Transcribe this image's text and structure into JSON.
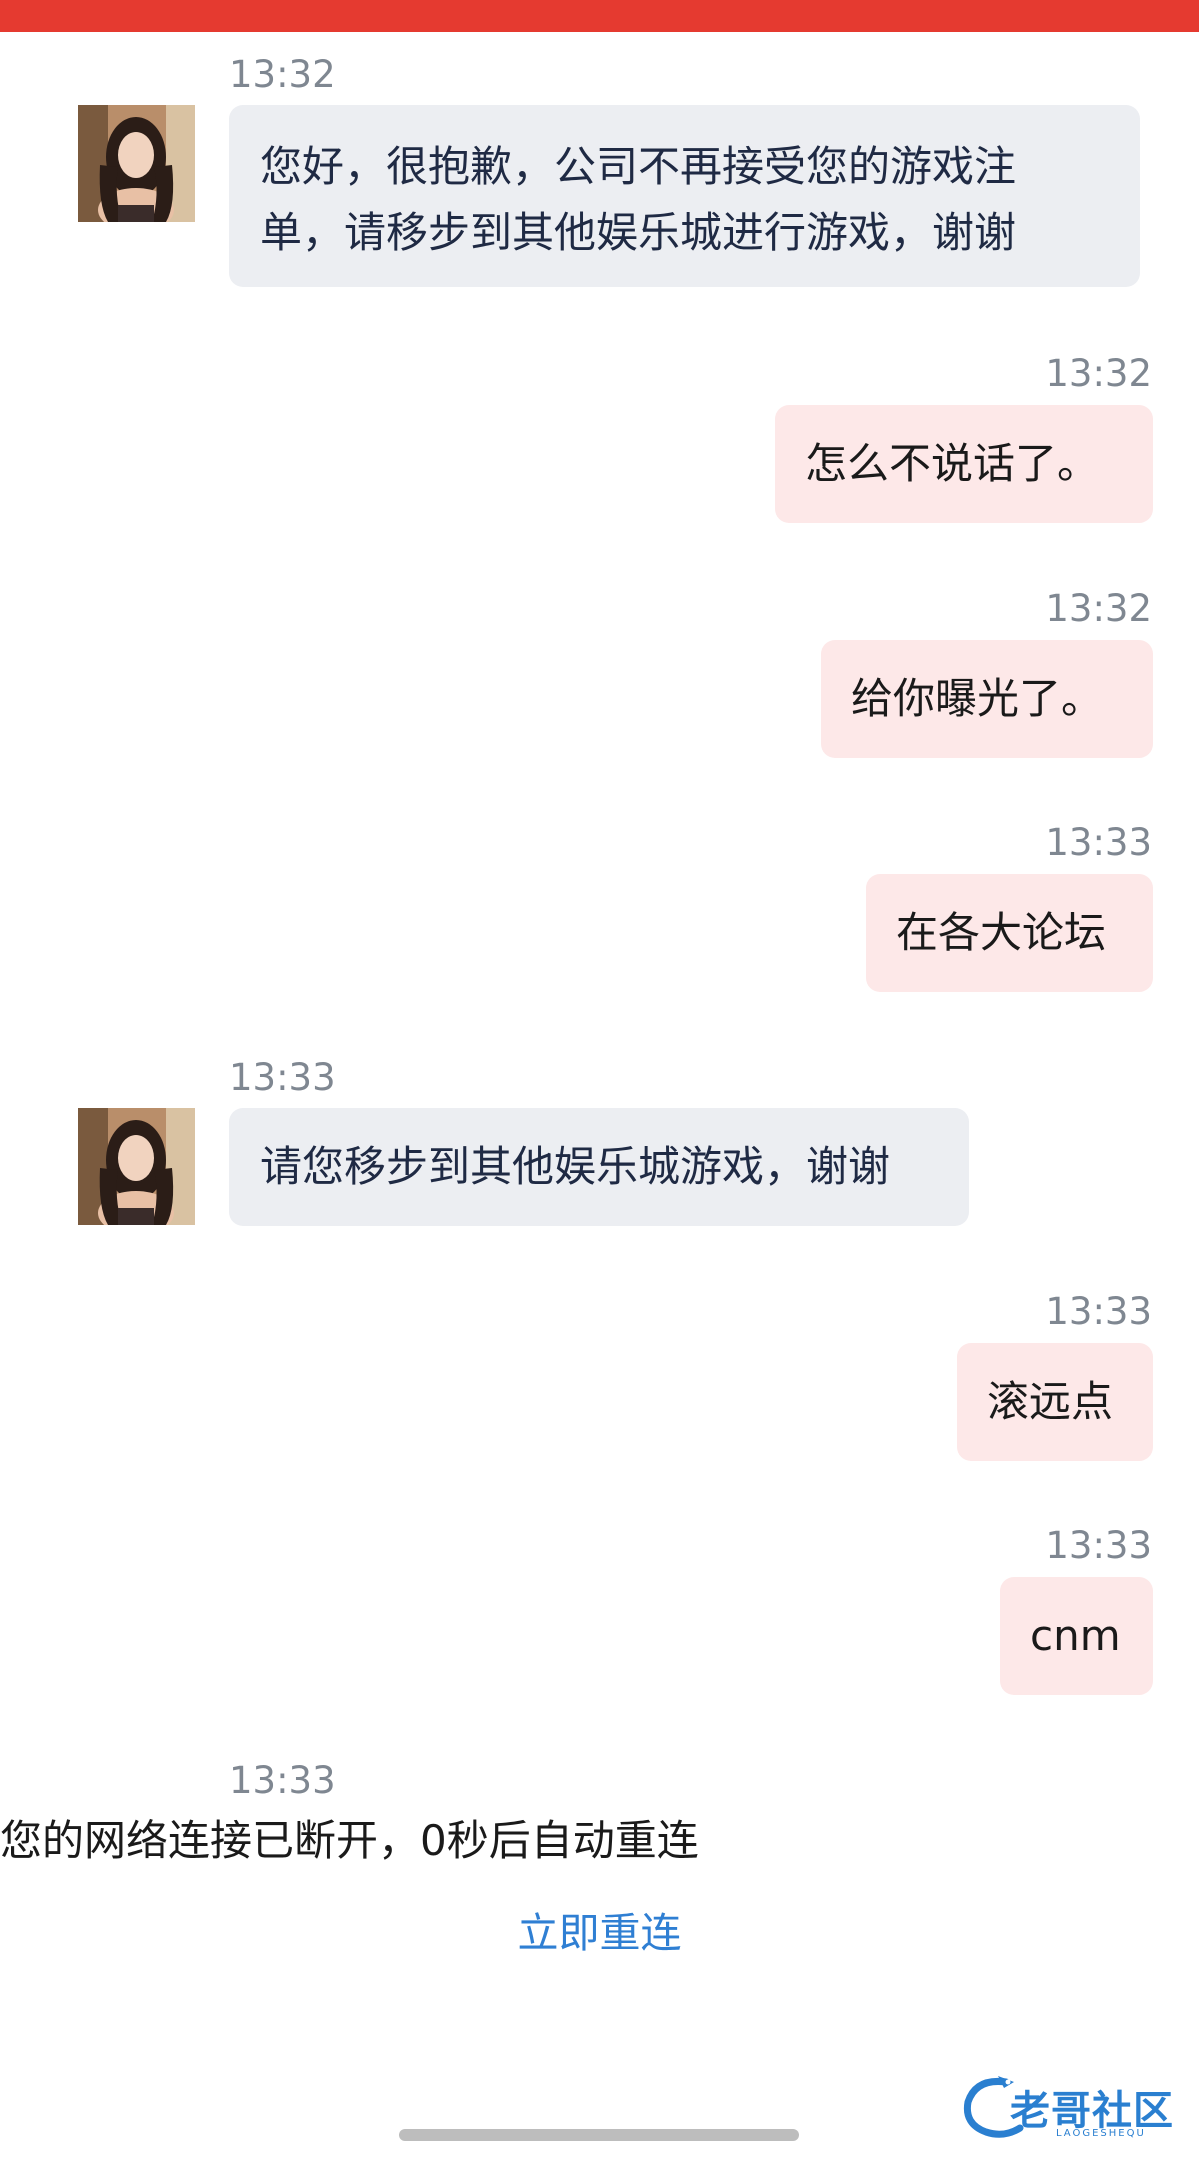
{
  "colors": {
    "status_bar": "#e53a30",
    "incoming_bubble": "#eceef2",
    "outgoing_bubble": "#fde8e8",
    "timestamp": "#7f8791",
    "link": "#2f7fd3"
  },
  "messages": [
    {
      "time": "13:32",
      "direction": "incoming",
      "lines": [
        "您好，很抱歉，公司不再接受您的游戏注",
        "单，请移步到其他娱乐城进行游戏，谢谢"
      ]
    },
    {
      "time": "13:32",
      "direction": "outgoing",
      "text": "怎么不说话了。"
    },
    {
      "time": "13:32",
      "direction": "outgoing",
      "text": "给你曝光了。"
    },
    {
      "time": "13:33",
      "direction": "outgoing",
      "text": "在各大论坛"
    },
    {
      "time": "13:33",
      "direction": "incoming",
      "text": "请您移步到其他娱乐城游戏，谢谢"
    },
    {
      "time": "13:33",
      "direction": "outgoing",
      "text": "滚远点"
    },
    {
      "time": "13:33",
      "direction": "outgoing",
      "text": "cnm"
    }
  ],
  "system": {
    "time": "13:33",
    "network_message": "您的网络连接已断开，0秒后自动重连",
    "reconnect_label": "立即重连"
  },
  "watermark": {
    "text": "老哥社区",
    "sub": "LAOGESHEQU"
  }
}
